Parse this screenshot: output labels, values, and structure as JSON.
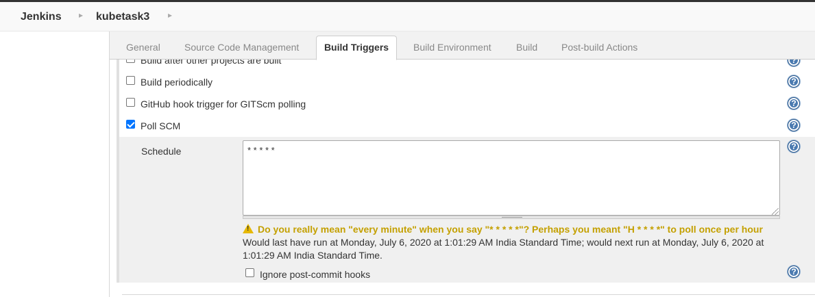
{
  "breadcrumb": {
    "root": "Jenkins",
    "job": "kubetask3",
    "separator": "▸"
  },
  "tabs": [
    {
      "label": "General",
      "active": false
    },
    {
      "label": "Source Code Management",
      "active": false
    },
    {
      "label": "Build Triggers",
      "active": true
    },
    {
      "label": "Build Environment",
      "active": false
    },
    {
      "label": "Build",
      "active": false
    },
    {
      "label": "Post-build Actions",
      "active": false
    }
  ],
  "triggers": [
    {
      "label": "Build after other projects are built",
      "checked": false
    },
    {
      "label": "Build periodically",
      "checked": false
    },
    {
      "label": "GitHub hook trigger for GITScm polling",
      "checked": false
    },
    {
      "label": "Poll SCM",
      "checked": true
    }
  ],
  "poll_scm": {
    "schedule_label": "Schedule",
    "schedule_value": "* * * * *",
    "warning": "Do you really mean \"every minute\" when you say \"* * * * *\"? Perhaps you meant \"H * * * *\" to poll once per hour",
    "info": "Would last have run at Monday, July 6, 2020 at 1:01:29 AM India Standard Time; would next run at Monday, July 6, 2020 at 1:01:29 AM India Standard Time.",
    "ignore_label": "Ignore post-commit hooks",
    "ignore_checked": false
  },
  "help_glyph": "?",
  "colors": {
    "checkbox_checked": "#0075ff",
    "help_icon": "#4a7ab0",
    "warning_text": "#c4a000",
    "panel_bg": "#f0f0f0"
  }
}
